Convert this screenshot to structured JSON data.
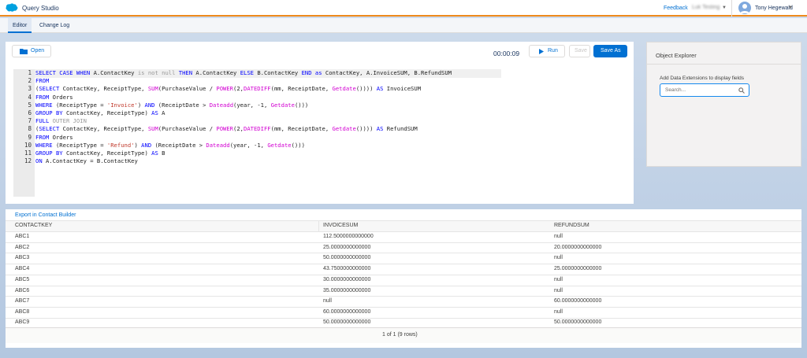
{
  "app": {
    "title": "Query Studio"
  },
  "header": {
    "feedback": "Feedback",
    "org": "Luk Testing",
    "user": "Tony Hegewald"
  },
  "tabs": [
    {
      "label": "Editor"
    },
    {
      "label": "Change Log"
    }
  ],
  "toolbar": {
    "open": "Open",
    "timer": "00:00:09",
    "run": "Run",
    "save": "Save",
    "save_as": "Save As"
  },
  "editor": {
    "lines": [
      "1",
      "2",
      "3",
      "4",
      "5",
      "6",
      "7",
      "8",
      "9",
      "10",
      "11",
      "12"
    ]
  },
  "explorer": {
    "title": "Object Explorer",
    "hint": "Add Data Extensions to display fields",
    "search_placeholder": "Search..."
  },
  "results": {
    "export": "Export in Contact Builder",
    "columns": [
      "CONTACTKEY",
      "INVOICESUM",
      "REFUNDSUM"
    ],
    "rows": [
      [
        "ABC1",
        "112.5000000000000",
        "null"
      ],
      [
        "ABC2",
        "25.0000000000000",
        "20.0000000000000"
      ],
      [
        "ABC3",
        "50.0000000000000",
        "null"
      ],
      [
        "ABC4",
        "43.7500000000000",
        "25.0000000000000"
      ],
      [
        "ABC5",
        "30.0000000000000",
        "null"
      ],
      [
        "ABC6",
        "35.0000000000000",
        "null"
      ],
      [
        "ABC7",
        "null",
        "60.0000000000000"
      ],
      [
        "ABC8",
        "60.0000000000000",
        "null"
      ],
      [
        "ABC9",
        "50.0000000000000",
        "50.0000000000000"
      ]
    ],
    "pager": "1 of 1 (9 rows)"
  },
  "colors": {
    "accent": "#0070d2",
    "orange": "#ee8a1c"
  }
}
